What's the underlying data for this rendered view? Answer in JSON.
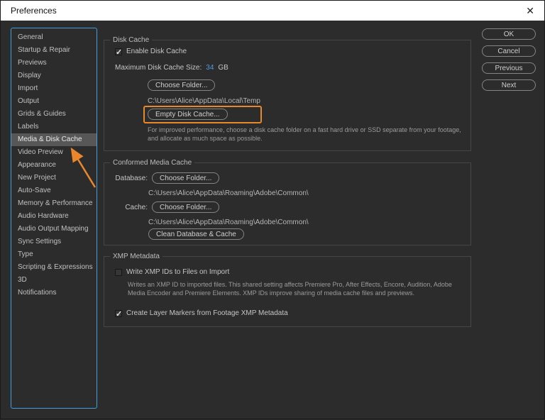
{
  "window": {
    "title": "Preferences",
    "close_glyph": "✕"
  },
  "sidebar": {
    "items": [
      {
        "label": "General"
      },
      {
        "label": "Startup & Repair"
      },
      {
        "label": "Previews"
      },
      {
        "label": "Display"
      },
      {
        "label": "Import"
      },
      {
        "label": "Output"
      },
      {
        "label": "Grids & Guides"
      },
      {
        "label": "Labels"
      },
      {
        "label": "Media & Disk Cache",
        "selected": true
      },
      {
        "label": "Video Preview"
      },
      {
        "label": "Appearance"
      },
      {
        "label": "New Project"
      },
      {
        "label": "Auto-Save"
      },
      {
        "label": "Memory & Performance"
      },
      {
        "label": "Audio Hardware"
      },
      {
        "label": "Audio Output Mapping"
      },
      {
        "label": "Sync Settings"
      },
      {
        "label": "Type"
      },
      {
        "label": "Scripting & Expressions"
      },
      {
        "label": "3D"
      },
      {
        "label": "Notifications"
      }
    ]
  },
  "actions": {
    "ok": "OK",
    "cancel": "Cancel",
    "previous": "Previous",
    "next": "Next"
  },
  "disk_cache": {
    "title": "Disk Cache",
    "enable_checkbox": {
      "label": "Enable Disk Cache",
      "checked": true
    },
    "max_size": {
      "label": "Maximum Disk Cache Size:",
      "value": "34",
      "unit": "GB"
    },
    "choose_folder_button": "Choose Folder...",
    "folder_path": "C:\\Users\\Alice\\AppData\\Local\\Temp",
    "empty_button": "Empty Disk Cache...",
    "help": "For improved performance, choose a disk cache folder on a fast hard drive or SSD separate from your footage, and allocate as much space as possible."
  },
  "conformed_media_cache": {
    "title": "Conformed Media Cache",
    "database": {
      "label": "Database:",
      "button": "Choose Folder...",
      "path": "C:\\Users\\Alice\\AppData\\Roaming\\Adobe\\Common\\"
    },
    "cache": {
      "label": "Cache:",
      "button": "Choose Folder...",
      "path": "C:\\Users\\Alice\\AppData\\Roaming\\Adobe\\Common\\"
    },
    "clean_button": "Clean Database & Cache"
  },
  "xmp_metadata": {
    "title": "XMP Metadata",
    "write_checkbox": {
      "label": "Write XMP IDs to Files on Import",
      "checked": false
    },
    "help": "Writes an XMP ID to imported files. This shared setting affects Premiere Pro, After Effects, Encore, Audition, Adobe Media Encoder and Premiere Elements. XMP IDs improve sharing of media cache files and previews.",
    "markers_checkbox": {
      "label": "Create Layer Markers from Footage XMP Metadata",
      "checked": true
    }
  },
  "annotations": {
    "highlight_color": "#e8872c"
  },
  "colors": {
    "accent_blue": "#3e9fe0",
    "value_blue": "#4e9be0"
  }
}
